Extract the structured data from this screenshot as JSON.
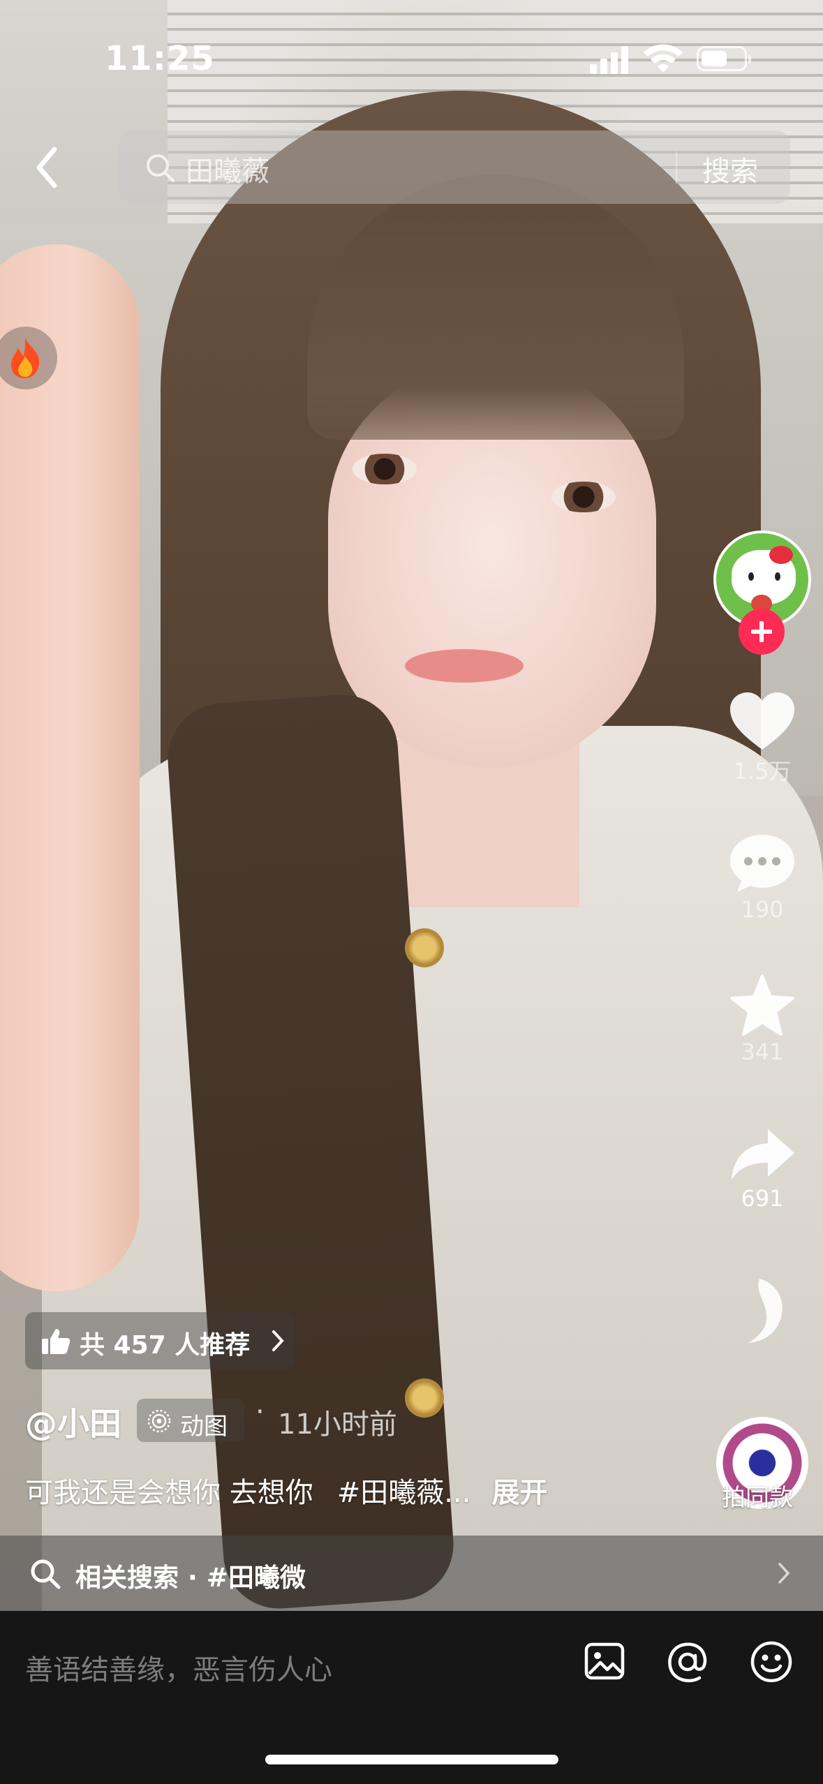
{
  "status_bar": {
    "time": "11:25"
  },
  "search": {
    "query": "田曦薇",
    "button_label": "搜索"
  },
  "actions": {
    "likes": "1.5万",
    "comments": "190",
    "favorites": "341",
    "shares": "691",
    "remix_label": "拍同款"
  },
  "info": {
    "recommend_text": "共 457 人推荐",
    "author": "@小田",
    "media_tag": "动图",
    "separator": "·",
    "time_ago": "11小时前",
    "description": "可我还是会想你 去想你",
    "hashtag": "#田曦薇...",
    "expand_label": "展开",
    "related_search": "相关搜索 · #田曦微"
  },
  "comment_bar": {
    "placeholder": "善语结善缘，恶言伤人心"
  },
  "colors": {
    "follow_red": "#fe2c55",
    "comment_bar_bg": "#161616"
  }
}
